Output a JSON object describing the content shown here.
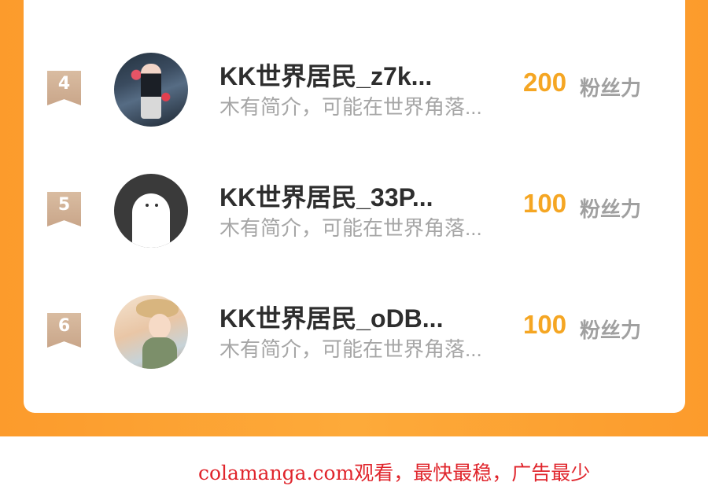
{
  "colors": {
    "accent": "#f5a623",
    "background": "#fc9b2c",
    "rank_badge": "#c9a68a",
    "watermark": "#e0252c"
  },
  "ranking": {
    "items": [
      {
        "rank": "4",
        "name": "KK世界居民_z7k...",
        "bio": "木有简介，可能在世界角落...",
        "score": "200",
        "unit": "粉丝力",
        "avatar": "anime-girl-avatar"
      },
      {
        "rank": "5",
        "name": "KK世界居民_33P...",
        "bio": "木有简介，可能在世界角落...",
        "score": "100",
        "unit": "粉丝力",
        "avatar": "default-avatar"
      },
      {
        "rank": "6",
        "name": "KK世界居民_oDB...",
        "bio": "木有简介，可能在世界角落...",
        "score": "100",
        "unit": "粉丝力",
        "avatar": "anime-girl-hat-avatar"
      }
    ]
  },
  "watermark": "colamanga.com观看，最快最稳，广告最少"
}
